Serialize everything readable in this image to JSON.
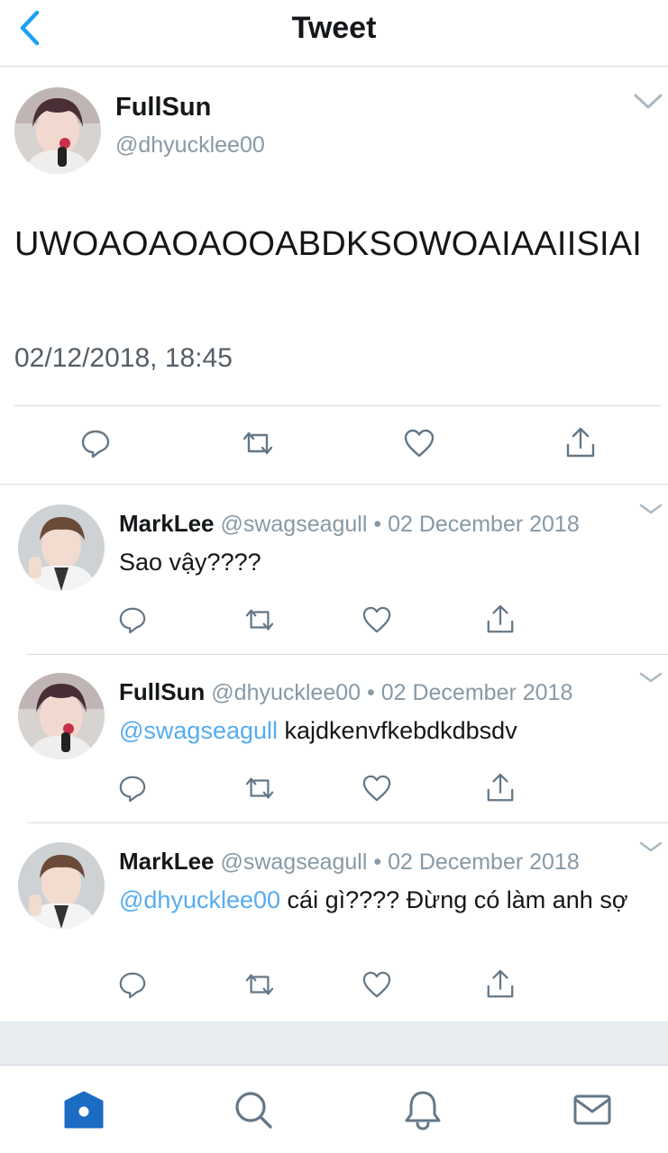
{
  "header": {
    "title": "Tweet",
    "back_icon": "chevron-left-icon"
  },
  "main_tweet": {
    "name": "FullSun",
    "handle": "@dhyucklee00",
    "text": "UWOAOAOAOOABDKSOWOAIAAIISIAI",
    "timestamp": "02/12/2018, 18:45",
    "actions": [
      "reply-icon",
      "retweet-icon",
      "like-icon",
      "share-icon"
    ]
  },
  "replies": [
    {
      "name": "MarkLee",
      "handle": "@swagseagull",
      "separator": "•",
      "date": "02 December 2018",
      "mention": "",
      "text": "Sao vậy????"
    },
    {
      "name": "FullSun",
      "handle": "@dhyucklee00",
      "separator": "•",
      "date": "02 December 2018",
      "mention": "@swagseagull",
      "text": "kajdkenvfkebdkdbsdv"
    },
    {
      "name": "MarkLee",
      "handle": "@swagseagull",
      "separator": "•",
      "date": "02 December 2018",
      "mention": "@dhyucklee00",
      "text": "cái gì???? Đừng có làm anh sợ"
    }
  ],
  "tabs": [
    "home-icon",
    "search-icon",
    "notifications-icon",
    "messages-icon"
  ],
  "colors": {
    "accent": "#1da1f2",
    "mention": "#55acee",
    "tab_active": "#1c6cc4",
    "muted": "#8899a6"
  }
}
